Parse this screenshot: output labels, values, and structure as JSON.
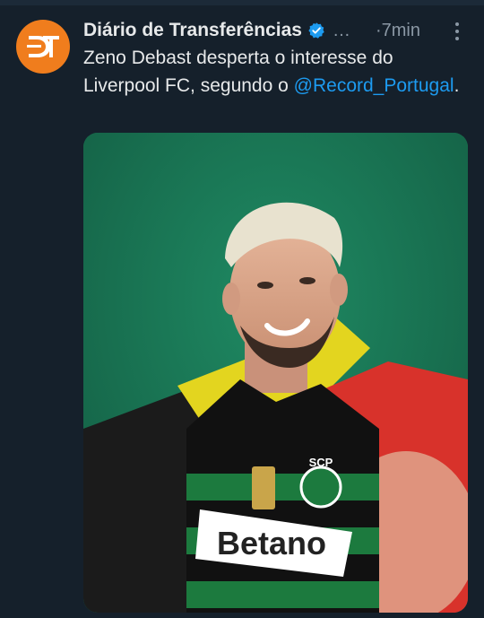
{
  "account": {
    "display_name": "Diário de Transferências",
    "ellipsis": "…",
    "separator": "·",
    "time": "7min",
    "avatar_logo": "DT"
  },
  "tweet": {
    "text_part1": "Zeno Debast desperta o interesse do Liverpool FC, segundo o",
    "mention": "@Record_Portugal",
    "text_end": "."
  },
  "media": {
    "kit_badge": "SCP",
    "sponsor": "Betano"
  },
  "colors": {
    "background": "#15202b",
    "accent": "#1d9bf0",
    "avatar": "#f07d1d",
    "muted": "#8b98a5"
  }
}
